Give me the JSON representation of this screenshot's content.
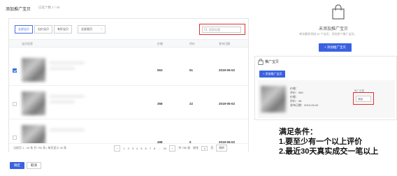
{
  "left_panel": {
    "title": "添加推广宝贝",
    "count": "已选个数 1 / 40",
    "filters": [
      "全部宝贝",
      "出价宝贝",
      "有折宝贝"
    ],
    "category_select": "全部类目",
    "search_placeholder": "搜索标题",
    "columns": {
      "title": "宝贝信息",
      "price": "价格",
      "reviews": "评价",
      "date": "发布日期"
    },
    "rows": [
      {
        "price": "553",
        "reviews": "51",
        "date": "2019-05-02",
        "checked": true
      },
      {
        "price": "358",
        "reviews": "22",
        "date": "2019-05-02",
        "checked": false
      },
      {
        "price": "498",
        "reviews": "0",
        "date": "2019-05-02",
        "checked": false
      }
    ],
    "footer": {
      "summary": "当前页 1 : 40 条  共 750 条  |  每页显示 40 条",
      "prev": "‹",
      "pages": [
        "1",
        "2",
        "3",
        "4",
        "5",
        "6",
        "7",
        "8",
        "...",
        "20"
      ],
      "next": "›",
      "total": "共 750 条",
      "goto_label": "前往",
      "goto_value": "2",
      "goto_suffix": "页",
      "jump": "跳转"
    },
    "confirm": "确定",
    "cancel": "取消"
  },
  "empty_state": {
    "title": "未添加推广宝贝",
    "subtitle": "单次最多添加 40 个宝贝，添加多个推广宝贝。",
    "add_button": "+ 添加推广宝贝"
  },
  "right_card": {
    "title": "推广宝贝",
    "add_button": "+ 添加推广宝贝",
    "item": {
      "lines": [
        "价格：",
        "评价：550",
        "价格：",
        "评价：56",
        "发布日期：2019-05-02"
      ],
      "side_label": "推广设置",
      "input_value": "添加"
    }
  },
  "annotation": {
    "lines": [
      "满足条件：",
      "1.要至少有一个以上评价",
      "2.最近30天真实成交一笔以上"
    ]
  },
  "colors": {
    "accent": "#3a62e0",
    "highlight": "#e03030"
  }
}
